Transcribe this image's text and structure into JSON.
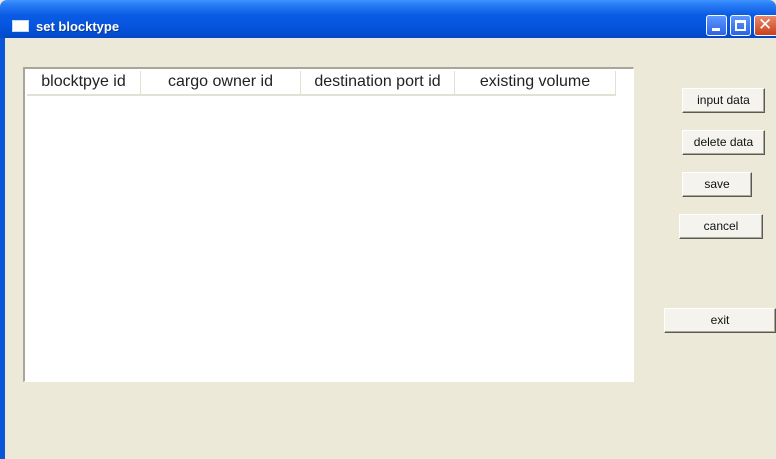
{
  "window": {
    "title": "set blocktype"
  },
  "table": {
    "columns": [
      "blocktpye id",
      "cargo owner id",
      "destination port id",
      "existing volume"
    ],
    "rows": []
  },
  "buttons": {
    "input_data": "input data",
    "delete_data": "delete data",
    "save": "save",
    "cancel": "cancel",
    "exit": "exit"
  }
}
